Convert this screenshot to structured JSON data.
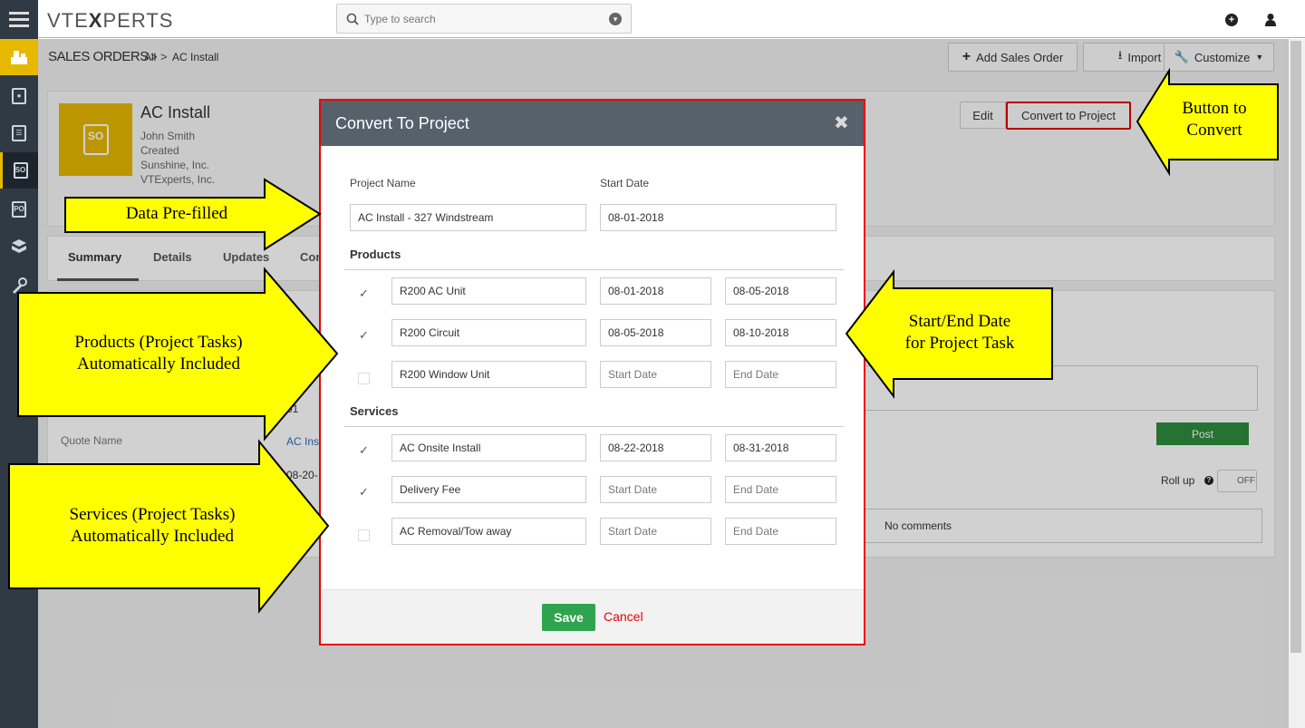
{
  "app": {
    "logo_left": "VTE",
    "logo_x": "X",
    "logo_right": "PERTS"
  },
  "search": {
    "placeholder": "Type to search"
  },
  "breadcrumb": {
    "module": "SALES ORDERS",
    "sep1": ">",
    "all": "All",
    "sep2": ">",
    "record": "AC Install"
  },
  "header_buttons": {
    "add": "Add Sales Order",
    "import": "Import",
    "customize": "Customize"
  },
  "sidebar_icons": [
    "sales-icon",
    "contacts-icon",
    "invoice-icon",
    "sales-order-icon",
    "purchase-order-icon",
    "products-icon",
    "tools-icon"
  ],
  "sidebar_labels": {
    "so": "SO",
    "po": "PO"
  },
  "record": {
    "badge": "SO",
    "title": "AC Install",
    "owner": "John Smith",
    "created": "Created",
    "account": "Sunshine, Inc.",
    "org": "VTExperts, Inc.",
    "edit": "Edit",
    "convert": "Convert to Project"
  },
  "tabs": [
    "Summary",
    "Details",
    "Updates",
    "Con"
  ],
  "summary": {
    "quote_label": "Quote Name",
    "quote_value": "AC Inst",
    "num_tail": "01",
    "date_partial": "08-20-",
    "post": "Post",
    "rollup": "Roll up",
    "rollup_state": "OFF",
    "no_comments": "No comments"
  },
  "modal": {
    "title": "Convert To Project",
    "close": "✖",
    "project_name_label": "Project Name",
    "start_date_label": "Start Date",
    "project_name": "AC Install - 327 Windstream",
    "start_date": "08-01-2018",
    "products_label": "Products",
    "services_label": "Services",
    "start_placeholder": "Start Date",
    "end_placeholder": "End Date",
    "products": [
      {
        "name": "R200 AC Unit",
        "checked": true,
        "start": "08-01-2018",
        "end": "08-05-2018"
      },
      {
        "name": "R200 Circuit",
        "checked": true,
        "start": "08-05-2018",
        "end": "08-10-2018"
      },
      {
        "name": "R200 Window Unit",
        "checked": false,
        "start": "",
        "end": ""
      }
    ],
    "services": [
      {
        "name": "AC Onsite Install",
        "checked": true,
        "start": "08-22-2018",
        "end": "08-31-2018"
      },
      {
        "name": "Delivery Fee",
        "checked": true,
        "start": "",
        "end": ""
      },
      {
        "name": "AC Removal/Tow away",
        "checked": false,
        "start": "",
        "end": ""
      }
    ],
    "save": "Save",
    "cancel": "Cancel"
  },
  "annotations": {
    "data_prefilled": "Data Pre-filled",
    "button_to_convert_1": "Button to",
    "button_to_convert_2": "Convert",
    "products_1": "Products (Project Tasks)",
    "products_2": "Automatically Included",
    "services_1": "Services (Project Tasks)",
    "services_2": "Automatically Included",
    "dates_1": "Start/End Date",
    "dates_2": "for Project Task"
  },
  "colors": {
    "accent": "#e6b800",
    "sidebar": "#2f3a44",
    "modal_header": "#56616b",
    "save": "#2ea44f",
    "post": "#2e8b3e",
    "highlight": "#e00000",
    "arrow": "#ffff00"
  }
}
